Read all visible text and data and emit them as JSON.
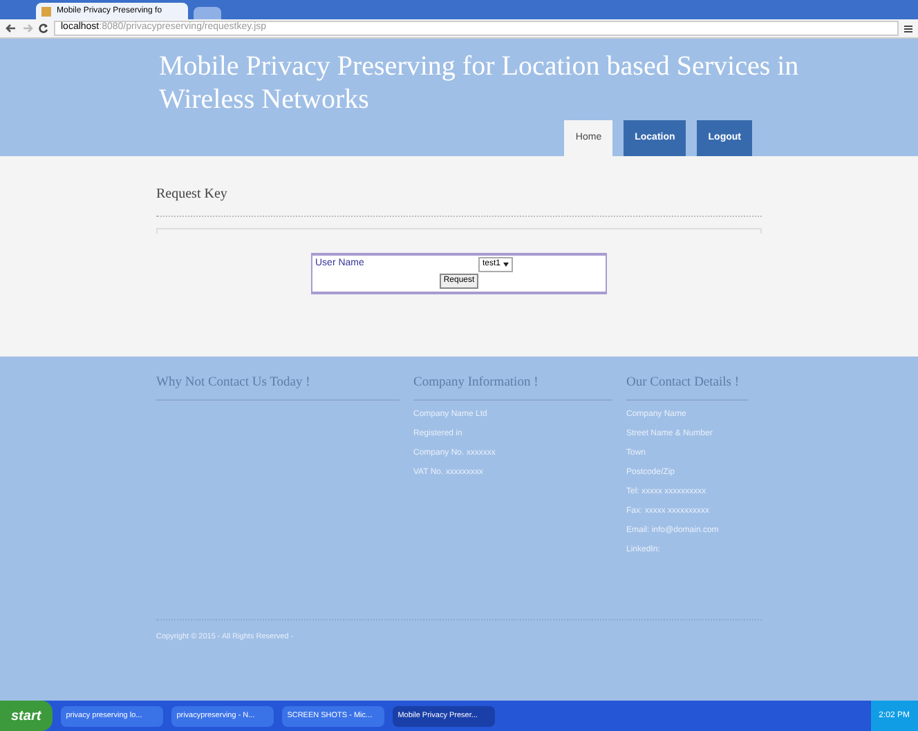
{
  "browser": {
    "tab_title": "Mobile Privacy Preserving fo",
    "url_host": "localhost",
    "url_path": ":8080/privacypreserving/requestkey.jsp"
  },
  "header": {
    "title": "Mobile Privacy Preserving for Location based Services in Wireless Networks",
    "nav": [
      {
        "label": "Home",
        "selected": true
      },
      {
        "label": "Location",
        "selected": false
      },
      {
        "label": "Logout",
        "selected": false
      }
    ]
  },
  "content": {
    "heading": "Request Key",
    "form": {
      "label": "User Name",
      "value": "test1",
      "button": "Request"
    }
  },
  "footer": {
    "columns": [
      {
        "title": "Why Not Contact Us Today !"
      },
      {
        "title": "Company Information !",
        "lines": [
          "Company Name Ltd",
          "Registered in",
          "Company No. xxxxxxx",
          "VAT No. xxxxxxxxx"
        ]
      },
      {
        "title": "Our Contact Details !",
        "lines": [
          "Company Name",
          "Street Name & Number",
          "Town",
          "Postcode/Zip",
          "Tel: xxxxx xxxxxxxxxx",
          "Fax: xxxxx xxxxxxxxxx",
          "Email: info@domain.com",
          "LinkedIn:"
        ]
      }
    ],
    "copyright": "Copyright © 2015 - All Rights Reserved -"
  },
  "taskbar": {
    "start": "start",
    "tasks": [
      {
        "label": "privacy preserving lo...",
        "selected": false
      },
      {
        "label": "privacypreserving - N...",
        "selected": false
      },
      {
        "label": "SCREEN SHOTS - Mic...",
        "selected": false
      },
      {
        "label": "Mobile Privacy Preser...",
        "selected": true
      }
    ],
    "clock": "2:02 PM"
  }
}
